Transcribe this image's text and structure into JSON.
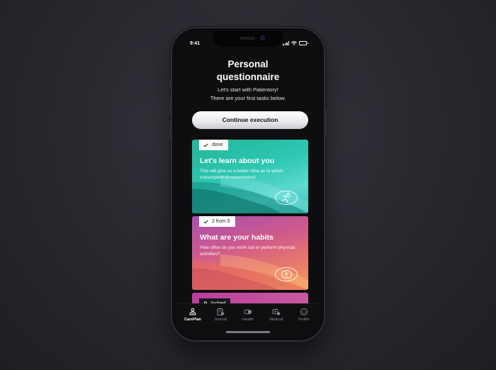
{
  "status_bar": {
    "time": "9:41"
  },
  "screen": {
    "title_line1": "Personal",
    "title_line2": "questionnaire",
    "subtitle_line1": "Let's start with Patientory!",
    "subtitle_line2": "There are your first tasks below.",
    "cta_label": "Continue execution"
  },
  "cards": [
    {
      "badge": "done",
      "badge_icon": "check-icon",
      "title": "Let's learn about you",
      "description": "This will give us a better idea as to which subscription to recommend.",
      "emblem_icon": "running-figure-icon",
      "color": "#2ec7b2"
    },
    {
      "badge": "2 from 5",
      "badge_icon": "check-icon",
      "title": "What are your habits",
      "description": "How often do you work out or perform physical activities?",
      "emblem_icon": "brain-icon",
      "color": "#e97a69"
    },
    {
      "badge": "locked",
      "badge_icon": "lock-icon",
      "color": "#bb3d9d"
    }
  ],
  "tabs": [
    {
      "label": "CarePlan",
      "icon": "careplan-icon",
      "active": true
    },
    {
      "label": "Journal",
      "icon": "journal-icon",
      "active": false
    },
    {
      "label": "Health",
      "icon": "health-icon",
      "active": false
    },
    {
      "label": "Medical",
      "icon": "medical-icon",
      "active": false
    },
    {
      "label": "Profile",
      "icon": "profile-icon",
      "active": false
    }
  ]
}
